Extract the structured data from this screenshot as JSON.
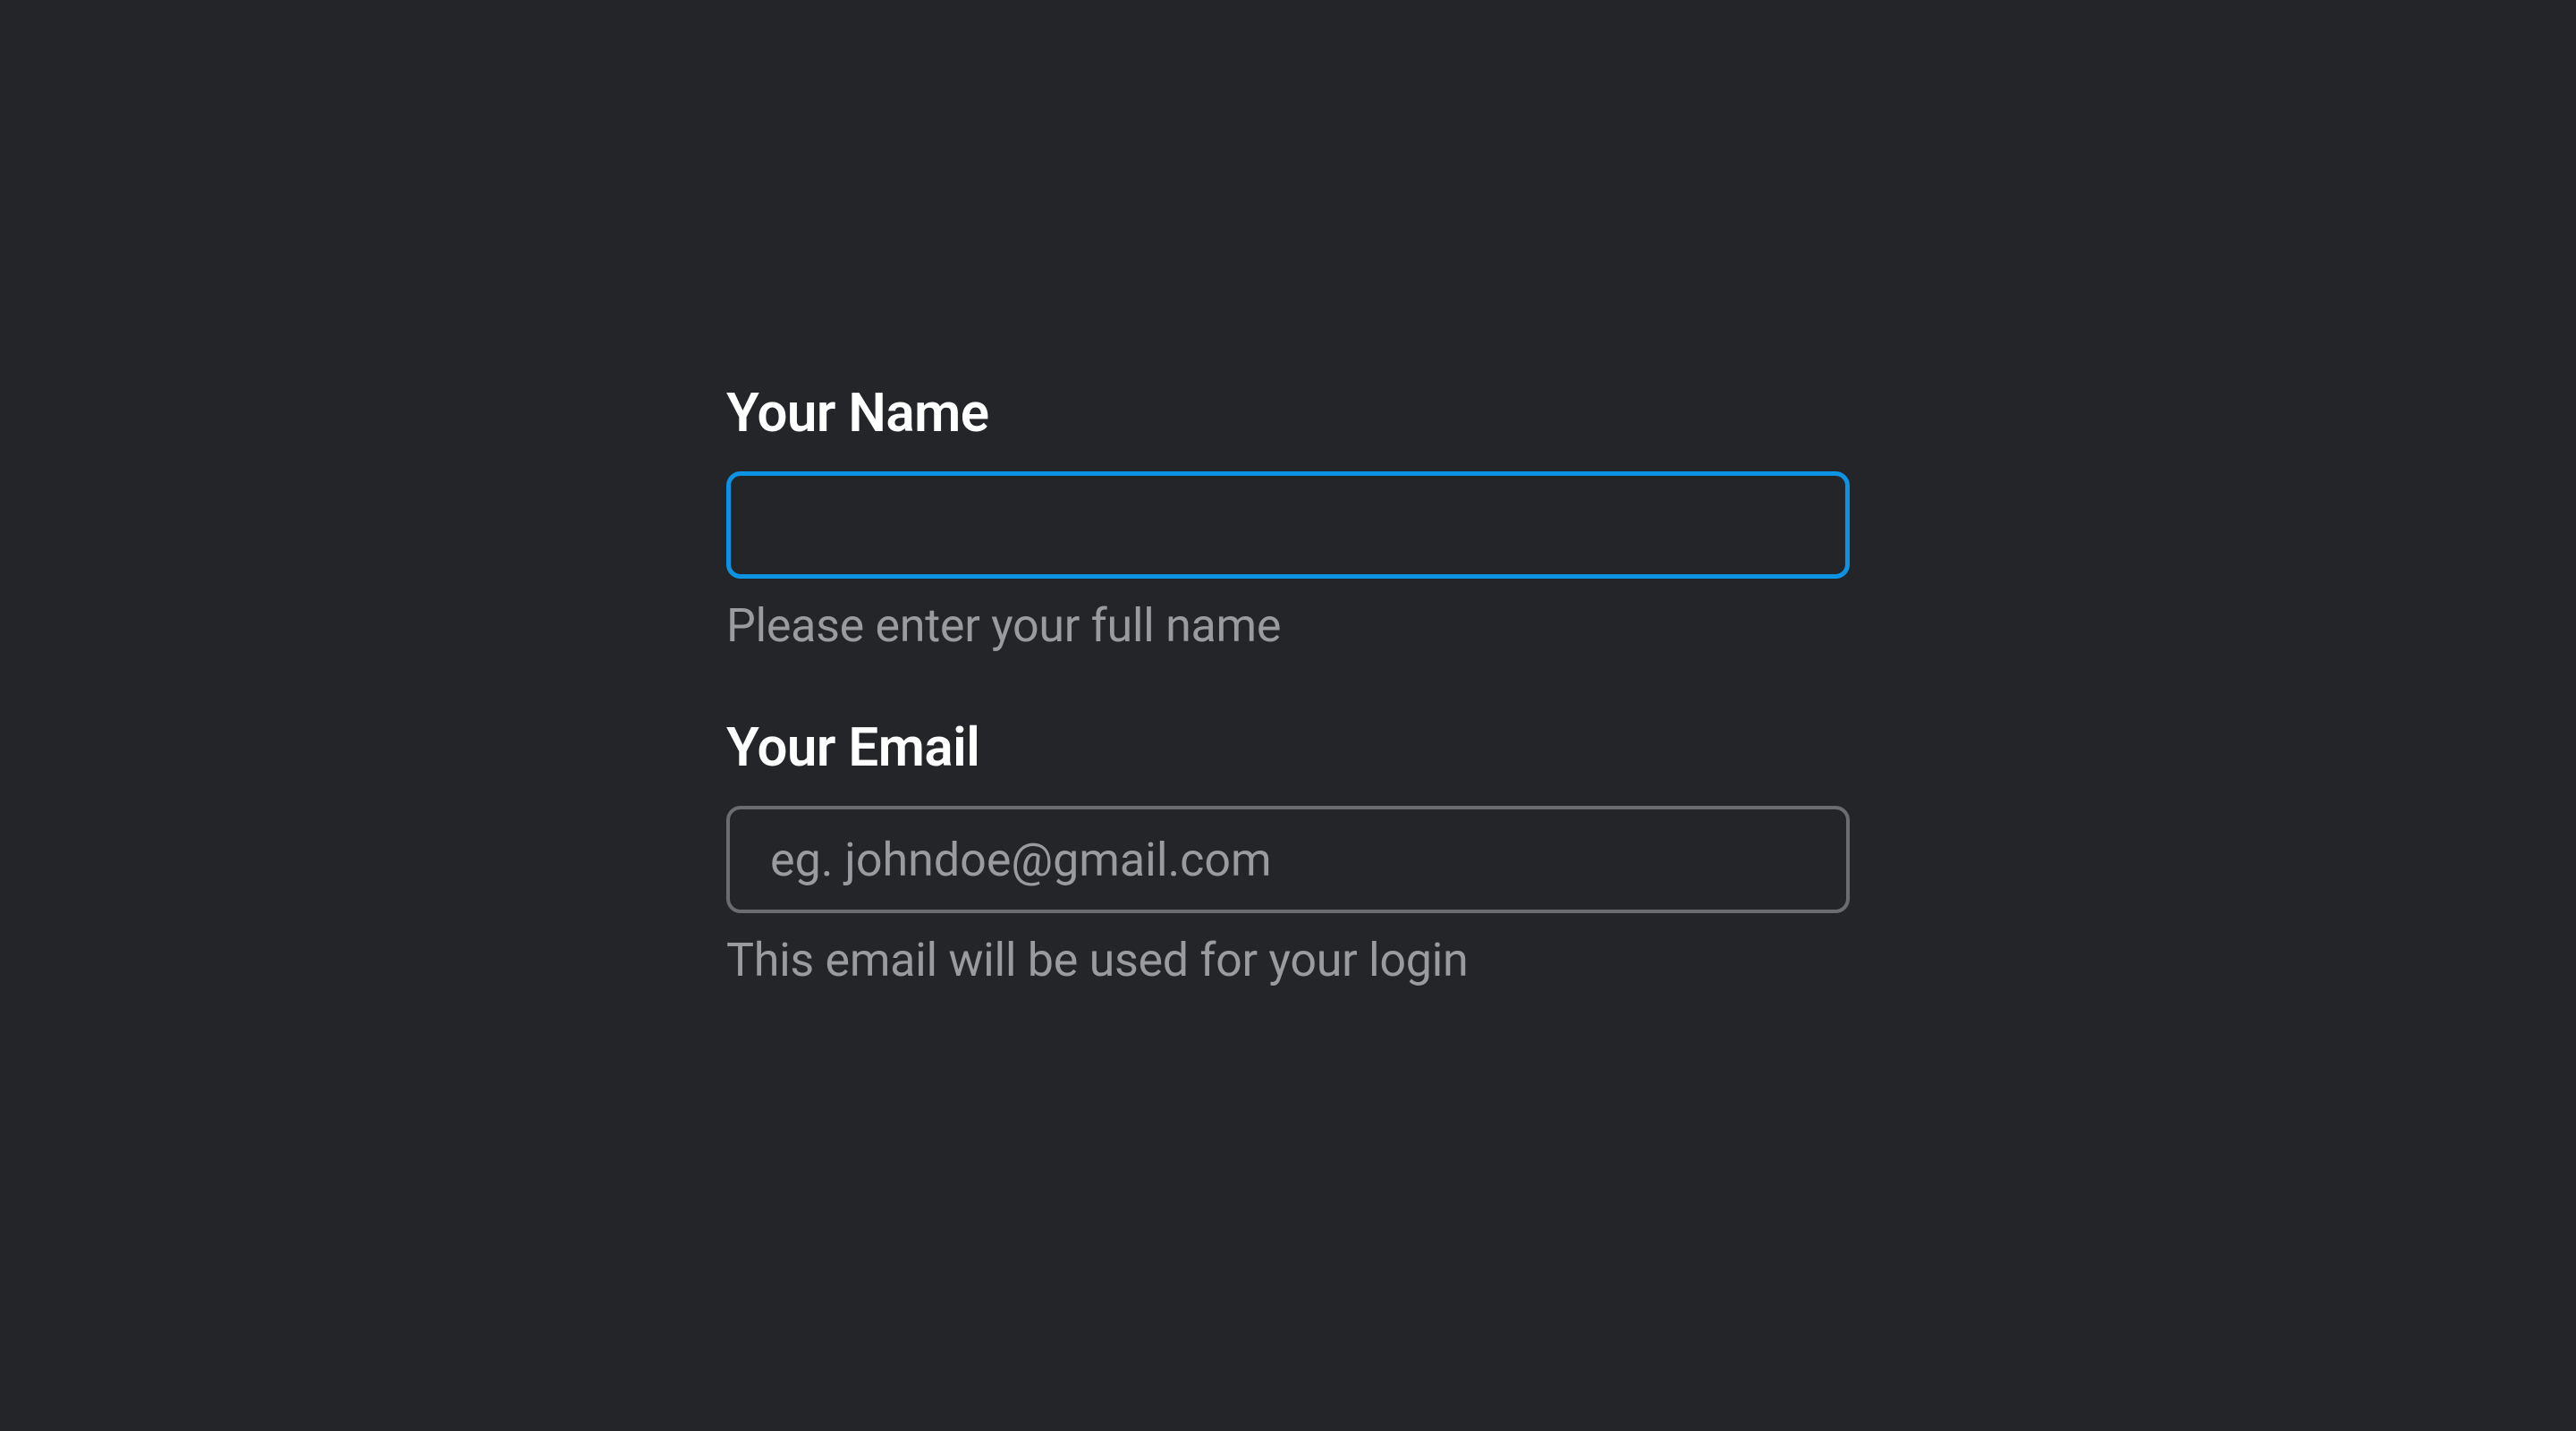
{
  "form": {
    "name": {
      "label": "Your Name",
      "value": "",
      "placeholder": "",
      "help": "Please enter your full name"
    },
    "email": {
      "label": "Your Email",
      "value": "",
      "placeholder": "eg. johndoe@gmail.com",
      "help": "This email will be used for your login"
    }
  }
}
